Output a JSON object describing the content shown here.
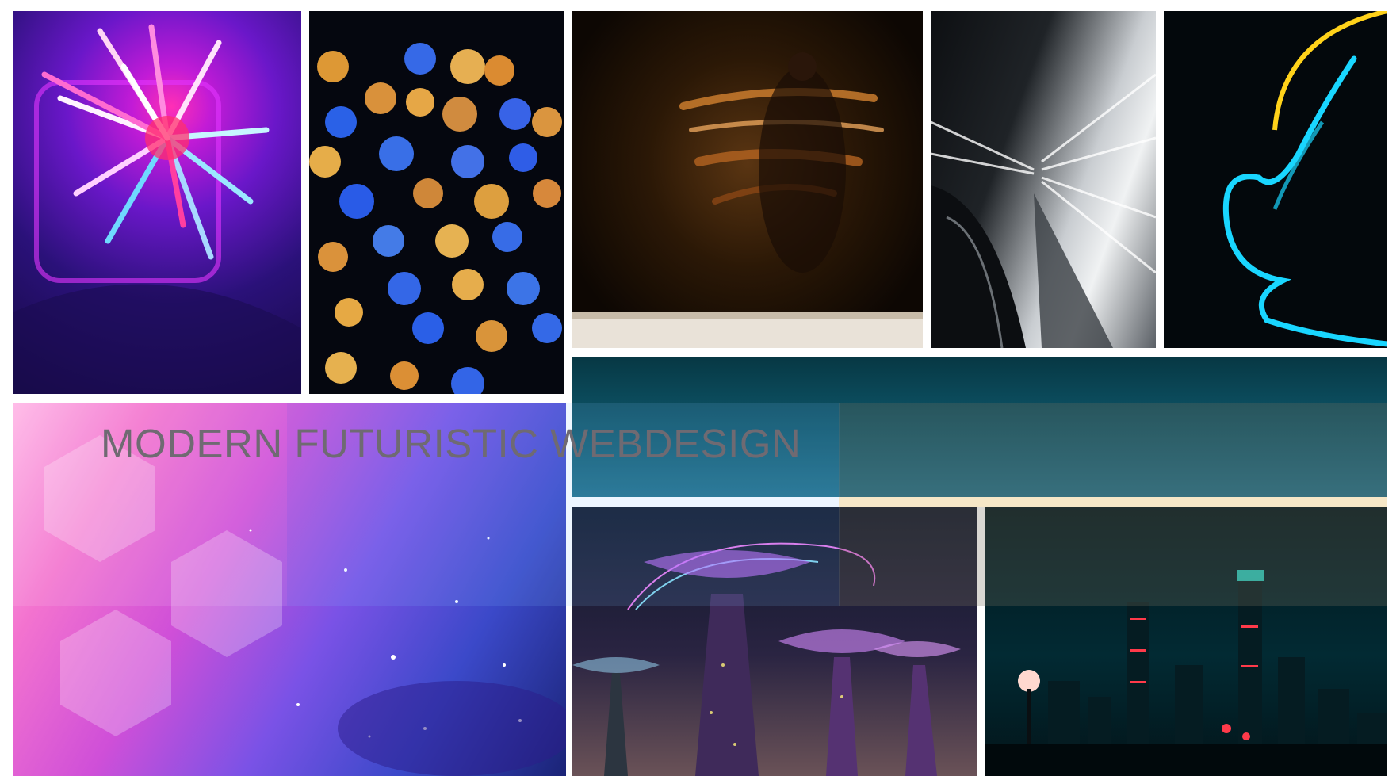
{
  "moodboard": {
    "title": "MODERN FUTURISTIC WEBDESIGN",
    "tiles": [
      {
        "icon": "neon-starburst-image"
      },
      {
        "icon": "bokeh-lights-image"
      },
      {
        "icon": "motion-blur-dancer-image"
      },
      {
        "icon": "car-tunnel-speed-image"
      },
      {
        "icon": "neon-guitar-image"
      },
      {
        "icon": "teal-texture-image"
      },
      {
        "icon": "galaxy-gradient-image"
      },
      {
        "icon": "supertree-grove-image"
      },
      {
        "icon": "night-city-skyline-image"
      }
    ],
    "colors": {
      "title_text": "#6f6a72",
      "neon_pink": "#ff2fb5",
      "neon_cyan": "#19d6ff",
      "neon_yellow": "#ffd21a",
      "teal": "#0d5366",
      "background": "#ffffff"
    }
  }
}
